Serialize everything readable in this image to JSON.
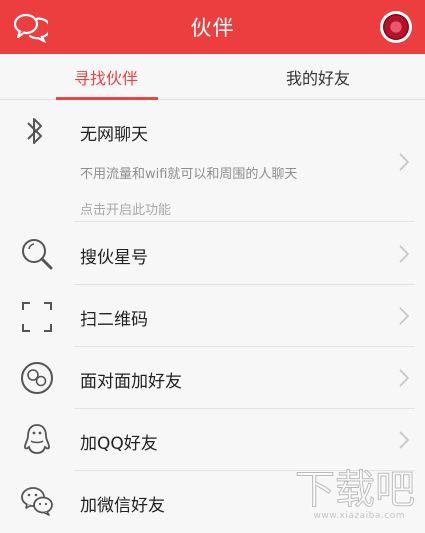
{
  "header": {
    "title": "伙伴",
    "left_icon": "chat-bubbles-icon",
    "right_icon": "avatar",
    "color": "#ec3e3e"
  },
  "tabs": [
    {
      "label": "寻找伙伴",
      "active": true
    },
    {
      "label": "我的好友",
      "active": false
    }
  ],
  "accent_color": "#e84545",
  "items": [
    {
      "label": "无网聊天",
      "description": "不用流量和wifi就可以和周围的人聊天",
      "hint": "点击开启此功能",
      "icon": "bluetooth-icon"
    },
    {
      "label": "搜伙星号",
      "icon": "search-icon"
    },
    {
      "label": "扫二维码",
      "icon": "scan-frame-icon"
    },
    {
      "label": "面对面加好友",
      "icon": "face-to-face-icon"
    },
    {
      "label": "加QQ好友",
      "icon": "qq-penguin-icon"
    },
    {
      "label": "加微信好友",
      "icon": "wechat-icon"
    }
  ],
  "watermark": {
    "text": "下载吧",
    "url": "www.xiazaiba.com",
    "icon": "watermark-logo-icon"
  }
}
